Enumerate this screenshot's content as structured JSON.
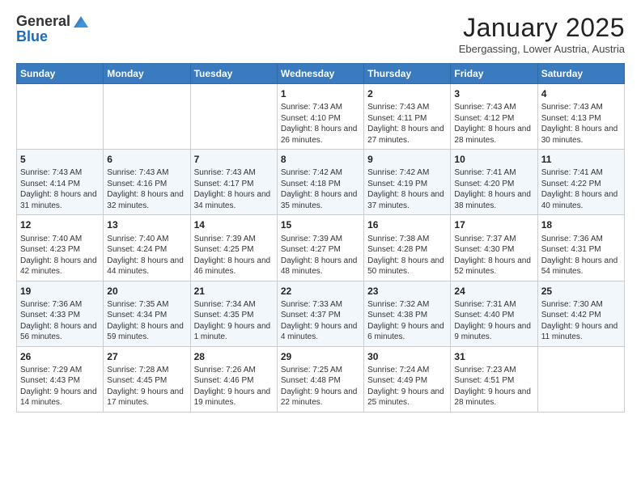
{
  "logo": {
    "general": "General",
    "blue": "Blue"
  },
  "header": {
    "month": "January 2025",
    "location": "Ebergassing, Lower Austria, Austria"
  },
  "days": [
    "Sunday",
    "Monday",
    "Tuesday",
    "Wednesday",
    "Thursday",
    "Friday",
    "Saturday"
  ],
  "weeks": [
    [
      {
        "day": "",
        "sunrise": "",
        "sunset": "",
        "daylight": ""
      },
      {
        "day": "",
        "sunrise": "",
        "sunset": "",
        "daylight": ""
      },
      {
        "day": "",
        "sunrise": "",
        "sunset": "",
        "daylight": ""
      },
      {
        "day": "1",
        "sunrise": "Sunrise: 7:43 AM",
        "sunset": "Sunset: 4:10 PM",
        "daylight": "Daylight: 8 hours and 26 minutes."
      },
      {
        "day": "2",
        "sunrise": "Sunrise: 7:43 AM",
        "sunset": "Sunset: 4:11 PM",
        "daylight": "Daylight: 8 hours and 27 minutes."
      },
      {
        "day": "3",
        "sunrise": "Sunrise: 7:43 AM",
        "sunset": "Sunset: 4:12 PM",
        "daylight": "Daylight: 8 hours and 28 minutes."
      },
      {
        "day": "4",
        "sunrise": "Sunrise: 7:43 AM",
        "sunset": "Sunset: 4:13 PM",
        "daylight": "Daylight: 8 hours and 30 minutes."
      }
    ],
    [
      {
        "day": "5",
        "sunrise": "Sunrise: 7:43 AM",
        "sunset": "Sunset: 4:14 PM",
        "daylight": "Daylight: 8 hours and 31 minutes."
      },
      {
        "day": "6",
        "sunrise": "Sunrise: 7:43 AM",
        "sunset": "Sunset: 4:16 PM",
        "daylight": "Daylight: 8 hours and 32 minutes."
      },
      {
        "day": "7",
        "sunrise": "Sunrise: 7:43 AM",
        "sunset": "Sunset: 4:17 PM",
        "daylight": "Daylight: 8 hours and 34 minutes."
      },
      {
        "day": "8",
        "sunrise": "Sunrise: 7:42 AM",
        "sunset": "Sunset: 4:18 PM",
        "daylight": "Daylight: 8 hours and 35 minutes."
      },
      {
        "day": "9",
        "sunrise": "Sunrise: 7:42 AM",
        "sunset": "Sunset: 4:19 PM",
        "daylight": "Daylight: 8 hours and 37 minutes."
      },
      {
        "day": "10",
        "sunrise": "Sunrise: 7:41 AM",
        "sunset": "Sunset: 4:20 PM",
        "daylight": "Daylight: 8 hours and 38 minutes."
      },
      {
        "day": "11",
        "sunrise": "Sunrise: 7:41 AM",
        "sunset": "Sunset: 4:22 PM",
        "daylight": "Daylight: 8 hours and 40 minutes."
      }
    ],
    [
      {
        "day": "12",
        "sunrise": "Sunrise: 7:40 AM",
        "sunset": "Sunset: 4:23 PM",
        "daylight": "Daylight: 8 hours and 42 minutes."
      },
      {
        "day": "13",
        "sunrise": "Sunrise: 7:40 AM",
        "sunset": "Sunset: 4:24 PM",
        "daylight": "Daylight: 8 hours and 44 minutes."
      },
      {
        "day": "14",
        "sunrise": "Sunrise: 7:39 AM",
        "sunset": "Sunset: 4:25 PM",
        "daylight": "Daylight: 8 hours and 46 minutes."
      },
      {
        "day": "15",
        "sunrise": "Sunrise: 7:39 AM",
        "sunset": "Sunset: 4:27 PM",
        "daylight": "Daylight: 8 hours and 48 minutes."
      },
      {
        "day": "16",
        "sunrise": "Sunrise: 7:38 AM",
        "sunset": "Sunset: 4:28 PM",
        "daylight": "Daylight: 8 hours and 50 minutes."
      },
      {
        "day": "17",
        "sunrise": "Sunrise: 7:37 AM",
        "sunset": "Sunset: 4:30 PM",
        "daylight": "Daylight: 8 hours and 52 minutes."
      },
      {
        "day": "18",
        "sunrise": "Sunrise: 7:36 AM",
        "sunset": "Sunset: 4:31 PM",
        "daylight": "Daylight: 8 hours and 54 minutes."
      }
    ],
    [
      {
        "day": "19",
        "sunrise": "Sunrise: 7:36 AM",
        "sunset": "Sunset: 4:33 PM",
        "daylight": "Daylight: 8 hours and 56 minutes."
      },
      {
        "day": "20",
        "sunrise": "Sunrise: 7:35 AM",
        "sunset": "Sunset: 4:34 PM",
        "daylight": "Daylight: 8 hours and 59 minutes."
      },
      {
        "day": "21",
        "sunrise": "Sunrise: 7:34 AM",
        "sunset": "Sunset: 4:35 PM",
        "daylight": "Daylight: 9 hours and 1 minute."
      },
      {
        "day": "22",
        "sunrise": "Sunrise: 7:33 AM",
        "sunset": "Sunset: 4:37 PM",
        "daylight": "Daylight: 9 hours and 4 minutes."
      },
      {
        "day": "23",
        "sunrise": "Sunrise: 7:32 AM",
        "sunset": "Sunset: 4:38 PM",
        "daylight": "Daylight: 9 hours and 6 minutes."
      },
      {
        "day": "24",
        "sunrise": "Sunrise: 7:31 AM",
        "sunset": "Sunset: 4:40 PM",
        "daylight": "Daylight: 9 hours and 9 minutes."
      },
      {
        "day": "25",
        "sunrise": "Sunrise: 7:30 AM",
        "sunset": "Sunset: 4:42 PM",
        "daylight": "Daylight: 9 hours and 11 minutes."
      }
    ],
    [
      {
        "day": "26",
        "sunrise": "Sunrise: 7:29 AM",
        "sunset": "Sunset: 4:43 PM",
        "daylight": "Daylight: 9 hours and 14 minutes."
      },
      {
        "day": "27",
        "sunrise": "Sunrise: 7:28 AM",
        "sunset": "Sunset: 4:45 PM",
        "daylight": "Daylight: 9 hours and 17 minutes."
      },
      {
        "day": "28",
        "sunrise": "Sunrise: 7:26 AM",
        "sunset": "Sunset: 4:46 PM",
        "daylight": "Daylight: 9 hours and 19 minutes."
      },
      {
        "day": "29",
        "sunrise": "Sunrise: 7:25 AM",
        "sunset": "Sunset: 4:48 PM",
        "daylight": "Daylight: 9 hours and 22 minutes."
      },
      {
        "day": "30",
        "sunrise": "Sunrise: 7:24 AM",
        "sunset": "Sunset: 4:49 PM",
        "daylight": "Daylight: 9 hours and 25 minutes."
      },
      {
        "day": "31",
        "sunrise": "Sunrise: 7:23 AM",
        "sunset": "Sunset: 4:51 PM",
        "daylight": "Daylight: 9 hours and 28 minutes."
      },
      {
        "day": "",
        "sunrise": "",
        "sunset": "",
        "daylight": ""
      }
    ]
  ]
}
